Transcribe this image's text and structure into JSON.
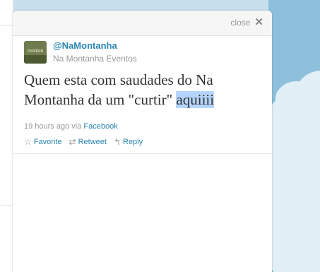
{
  "header": {
    "close_label": "close",
    "close_icon": "✕"
  },
  "tweet": {
    "screen_name": "@NaMontanha",
    "display_name": "Na Montanha Eventos",
    "avatar_text": "montan",
    "text_before": "Quem esta com saudades do Na Montanha da um \"curtir\" ",
    "text_highlight": "aquiiii",
    "time": "19 hours ago",
    "via": "via",
    "source": "Facebook"
  },
  "actions": {
    "favorite": "Favorite",
    "retweet": "Retweet",
    "reply": "Reply",
    "favorite_icon": "☆",
    "retweet_icon": "⇄",
    "reply_icon": "↰"
  },
  "colors": {
    "link": "#2a85b3",
    "highlight": "#b5d5ff",
    "sky": "#8ec0dc"
  }
}
